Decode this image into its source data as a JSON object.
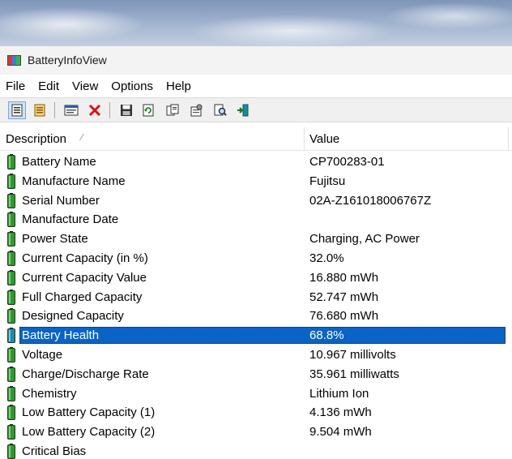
{
  "window": {
    "title": "BatteryInfoView"
  },
  "menu": [
    {
      "id": "file",
      "label": "File"
    },
    {
      "id": "edit",
      "label": "Edit"
    },
    {
      "id": "view",
      "label": "View"
    },
    {
      "id": "options",
      "label": "Options"
    },
    {
      "id": "help",
      "label": "Help"
    }
  ],
  "toolbar": {
    "buttons": [
      "battery-info-mode-icon",
      "battery-log-mode-icon",
      "properties-window-icon",
      "delete-icon",
      "save-icon",
      "refresh-icon",
      "copy-icon",
      "properties-icon",
      "find-icon",
      "exit-icon"
    ]
  },
  "columns": {
    "description": "Description",
    "value": "Value"
  },
  "rows": [
    {
      "description": "Battery Name",
      "value": "CP700283-01"
    },
    {
      "description": "Manufacture Name",
      "value": "Fujitsu"
    },
    {
      "description": "Serial Number",
      "value": "02A-Z161018006767Z"
    },
    {
      "description": "Manufacture Date",
      "value": ""
    },
    {
      "description": "Power State",
      "value": "Charging, AC Power"
    },
    {
      "description": "Current Capacity (in %)",
      "value": "32.0%"
    },
    {
      "description": "Current Capacity Value",
      "value": "16.880 mWh"
    },
    {
      "description": "Full Charged Capacity",
      "value": "52.747 mWh"
    },
    {
      "description": "Designed Capacity",
      "value": "76.680 mWh"
    },
    {
      "description": "Battery Health",
      "value": "68.8%",
      "selected": true
    },
    {
      "description": "Voltage",
      "value": "10.967 millivolts"
    },
    {
      "description": "Charge/Discharge Rate",
      "value": "35.961 milliwatts"
    },
    {
      "description": "Chemistry",
      "value": "Lithium Ion"
    },
    {
      "description": "Low Battery Capacity (1)",
      "value": "4.136 mWh"
    },
    {
      "description": "Low Battery Capacity (2)",
      "value": "9.504 mWh"
    },
    {
      "description": "Critical Bias",
      "value": ""
    }
  ],
  "colors": {
    "selection": "#0a64c8",
    "battery_green": "#2e9a2e",
    "battery_selected": "#1e8aa8"
  }
}
